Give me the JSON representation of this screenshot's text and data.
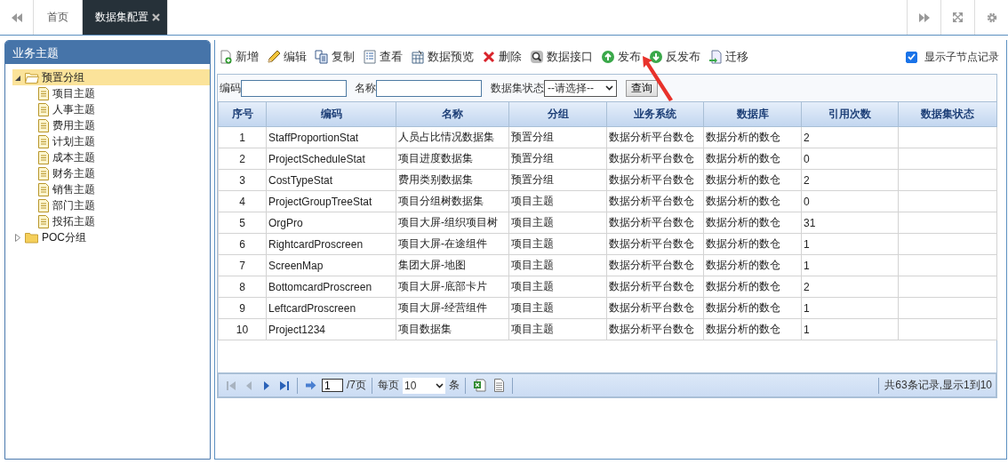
{
  "tabs": [
    {
      "label": "首页",
      "selected": false,
      "closable": false
    },
    {
      "label": "数据集配置",
      "selected": true,
      "closable": true
    }
  ],
  "sidebar": {
    "title": "业务主题",
    "tree": [
      {
        "label": "预置分组",
        "expanded": true,
        "selected": true,
        "children": [
          {
            "label": "项目主题"
          },
          {
            "label": "人事主题"
          },
          {
            "label": "费用主题"
          },
          {
            "label": "计划主题"
          },
          {
            "label": "成本主题"
          },
          {
            "label": "财务主题"
          },
          {
            "label": "销售主题"
          },
          {
            "label": "部门主题"
          },
          {
            "label": "投拓主题"
          }
        ]
      },
      {
        "label": "POC分组",
        "expanded": false,
        "selected": false
      }
    ]
  },
  "toolbar": [
    {
      "kind": "new",
      "label": "新增"
    },
    {
      "kind": "edit",
      "label": "编辑"
    },
    {
      "kind": "copy",
      "label": "复制"
    },
    {
      "kind": "view",
      "label": "查看"
    },
    {
      "kind": "preview",
      "label": "数据预览"
    },
    {
      "kind": "delete",
      "label": "删除"
    },
    {
      "kind": "api",
      "label": "数据接口"
    },
    {
      "kind": "publish",
      "label": "发布"
    },
    {
      "kind": "unpublish",
      "label": "反发布"
    },
    {
      "kind": "migrate",
      "label": "迁移"
    }
  ],
  "show_children": {
    "label": "显示子节点记录",
    "checked": true
  },
  "filters": {
    "code_label": "编码",
    "name_label": "名称",
    "status_label": "数据集状态",
    "status_value": "--请选择--",
    "query_button": "查询"
  },
  "table": {
    "columns": [
      "序号",
      "编码",
      "名称",
      "分组",
      "业务系统",
      "数据库",
      "引用次数",
      "数据集状态"
    ],
    "rows": [
      [
        "1",
        "StaffProportionStat",
        "人员占比情况数据集",
        "预置分组",
        "数据分析平台数仓",
        "数据分析的数仓",
        "2"
      ],
      [
        "2",
        "ProjectScheduleStat",
        "项目进度数据集",
        "预置分组",
        "数据分析平台数仓",
        "数据分析的数仓",
        "0"
      ],
      [
        "3",
        "CostTypeStat",
        "费用类别数据集",
        "预置分组",
        "数据分析平台数仓",
        "数据分析的数仓",
        "2"
      ],
      [
        "4",
        "ProjectGroupTreeStat",
        "项目分组树数据集",
        "项目主题",
        "数据分析平台数仓",
        "数据分析的数仓",
        "0"
      ],
      [
        "5",
        "OrgPro",
        "项目大屏-组织项目树",
        "项目主题",
        "数据分析平台数仓",
        "数据分析的数仓",
        "31"
      ],
      [
        "6",
        "RightcardProscreen",
        "项目大屏-在途组件",
        "项目主题",
        "数据分析平台数仓",
        "数据分析的数仓",
        "1"
      ],
      [
        "7",
        "ScreenMap",
        "集团大屏-地图",
        "项目主题",
        "数据分析平台数仓",
        "数据分析的数仓",
        "1"
      ],
      [
        "8",
        "BottomcardProscreen",
        "项目大屏-底部卡片",
        "项目主题",
        "数据分析平台数仓",
        "数据分析的数仓",
        "2"
      ],
      [
        "9",
        "LeftcardProscreen",
        "项目大屏-经营组件",
        "项目主题",
        "数据分析平台数仓",
        "数据分析的数仓",
        "1"
      ],
      [
        "10",
        "Project1234",
        "项目数据集",
        "项目主题",
        "数据分析平台数仓",
        "数据分析的数仓",
        "1"
      ]
    ]
  },
  "pager": {
    "page": "1",
    "total_pages": "/7页",
    "per_page_label": "每页",
    "per_page": "10",
    "unit": "条",
    "summary": "共63条记录,显示1到10",
    "first_disabled": true,
    "prev_disabled": true
  }
}
